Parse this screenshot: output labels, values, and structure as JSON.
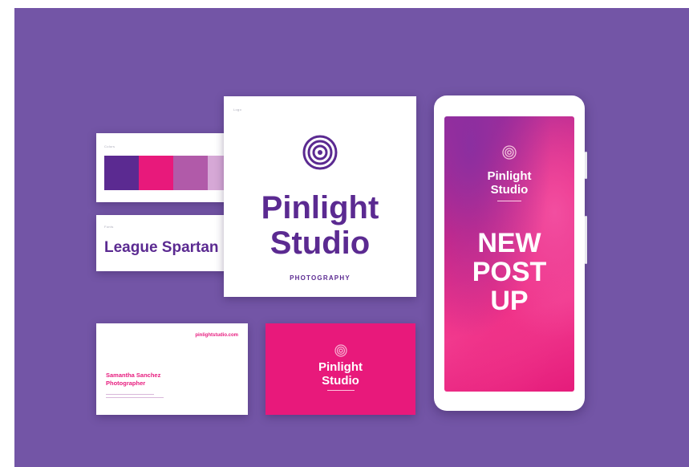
{
  "palette": {
    "label": "Colors",
    "colors": [
      "#5b2a91",
      "#e8197b",
      "#b15aa9",
      "#d6a8d6"
    ]
  },
  "font_card": {
    "label": "Fonts",
    "font_name": "League Spartan"
  },
  "logo_card": {
    "label": "Logo",
    "line1": "Pinlight",
    "line2": "Studio",
    "tagline": "PHOTOGRAPHY"
  },
  "business_card": {
    "url": "pinlightstudio.com",
    "name_line1": "Samantha Sanchez",
    "name_line2": "Photographer"
  },
  "business_card_back": {
    "line1": "Pinlight",
    "line2": "Studio"
  },
  "phone_post": {
    "brand_line1": "Pinlight",
    "brand_line2": "Studio",
    "headline_line1": "NEW",
    "headline_line2": "POST",
    "headline_line3": "UP"
  },
  "colors": {
    "background": "#7355a6",
    "brand_purple": "#5b2a91",
    "brand_pink": "#e8197b"
  }
}
